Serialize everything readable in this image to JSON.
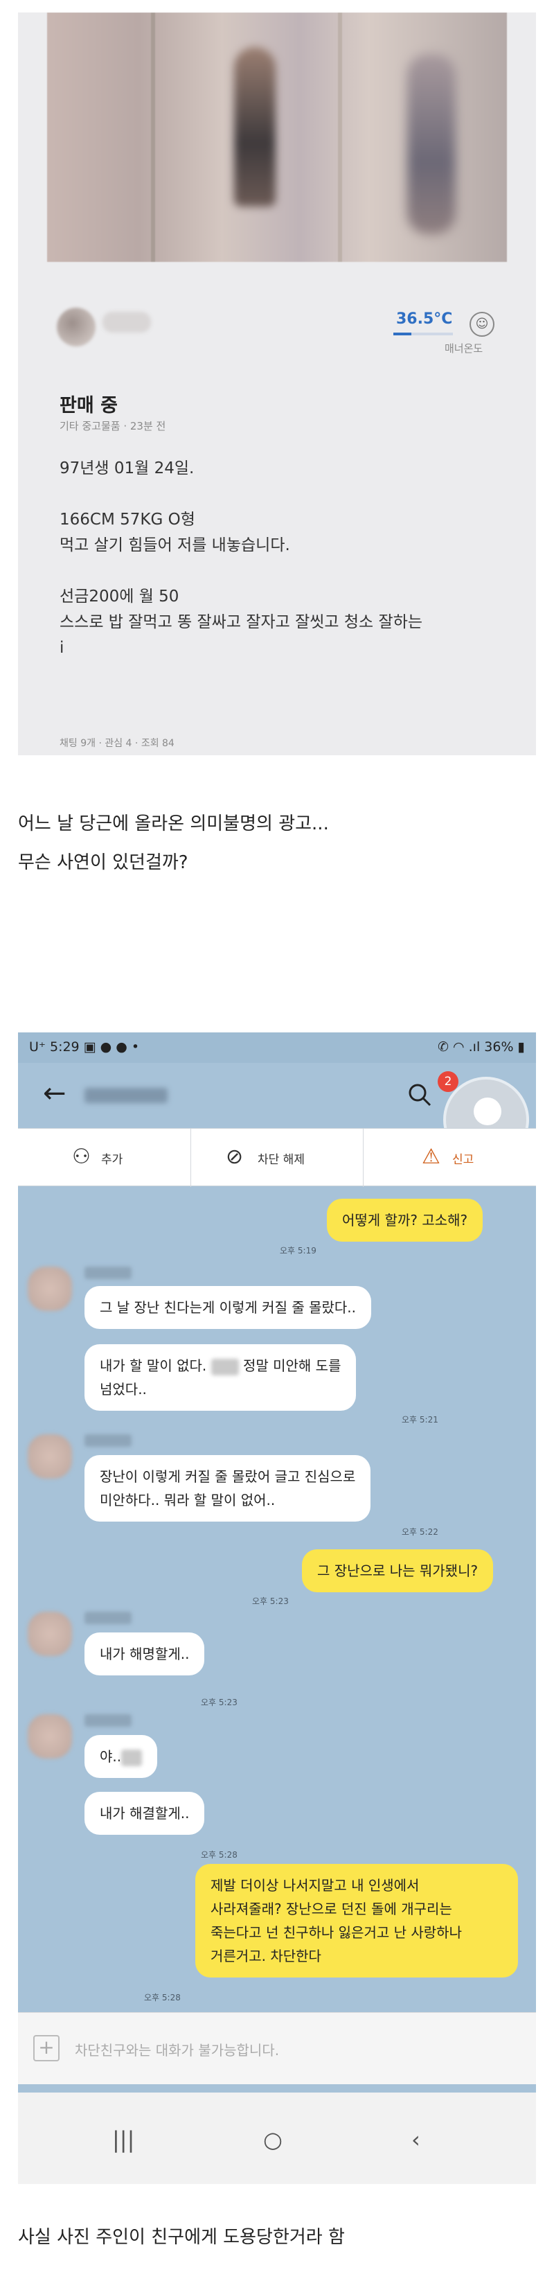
{
  "listing": {
    "temperature": "36.5°C",
    "temperature_fill": 0.3,
    "manner_label": "매너온도",
    "status": "판매 중",
    "meta": "기타 중고물품 · 23분 전",
    "lines": [
      "97년생 01월 24일.",
      "",
      "166CM 57KG O형",
      "먹고 살기 힘들어 저를 내놓습니다.",
      "",
      "선금200에 월 50",
      "스스로 밥 잘먹고 똥 잘싸고 잘자고 잘씻고 청소 잘하는",
      "i"
    ],
    "stats": "채팅 9개 · 관심 4 · 조회 84"
  },
  "captions": {
    "line1": "어느 날 당근에 올라온 의미불명의 광고...",
    "line2": "무슨 사연이 있던걸까?",
    "line3": "사실 사진 주인이 친구에게 도용당한거라 함"
  },
  "phone": {
    "status_left": "U⁺ 5:29 ▣ ● ● •",
    "status_right": "✆ ◠ .ıl 36% ▮",
    "badge_count": "2",
    "actions": {
      "add": "추가",
      "unblock": "차단 해제",
      "report": "신고"
    },
    "icons": {
      "back": "back-arrow-icon",
      "search": "search-icon",
      "add": "add-friend-icon",
      "unblock": "block-icon",
      "report": "siren-icon"
    }
  },
  "chat": {
    "m1": "어떻게 할까? 고소해?",
    "t1": "오후 5:19",
    "m2": "그 날 장난 친다는게 이렇게 커질 줄 몰랐다..",
    "m3a": "내가 할 말이 없다.",
    "m3b": "정말 미안해 도를",
    "m3c": "넘었다..",
    "t3": "오후 5:21",
    "m4a": "장난이 이렇게 커질 줄 몰랐어 글고 진심으로",
    "m4b": "미안하다.. 뭐라 할 말이 없어..",
    "t4": "오후 5:22",
    "m5": "그 장난으로 나는 뭐가됐니?",
    "t5": "오후 5:23",
    "m6": "내가 해명할게..",
    "t6": "오후 5:23",
    "m7": "야..",
    "m8": "내가 해결할게..",
    "t8": "오후 5:28",
    "m9a": "제발 더이상 나서지말고 내 인생에서",
    "m9b": "사라져줄래? 장난으로 던진 돌에 개구리는",
    "m9c": "죽는다고 넌 친구하나 잃은거고 난 사랑하나",
    "m9d": "거른거고. 차단한다",
    "t9": "오후 5:28",
    "input_placeholder": "차단친구와는 대화가 불가능합니다."
  },
  "nav": {
    "recent": "|||",
    "home": "○",
    "back": "‹"
  }
}
